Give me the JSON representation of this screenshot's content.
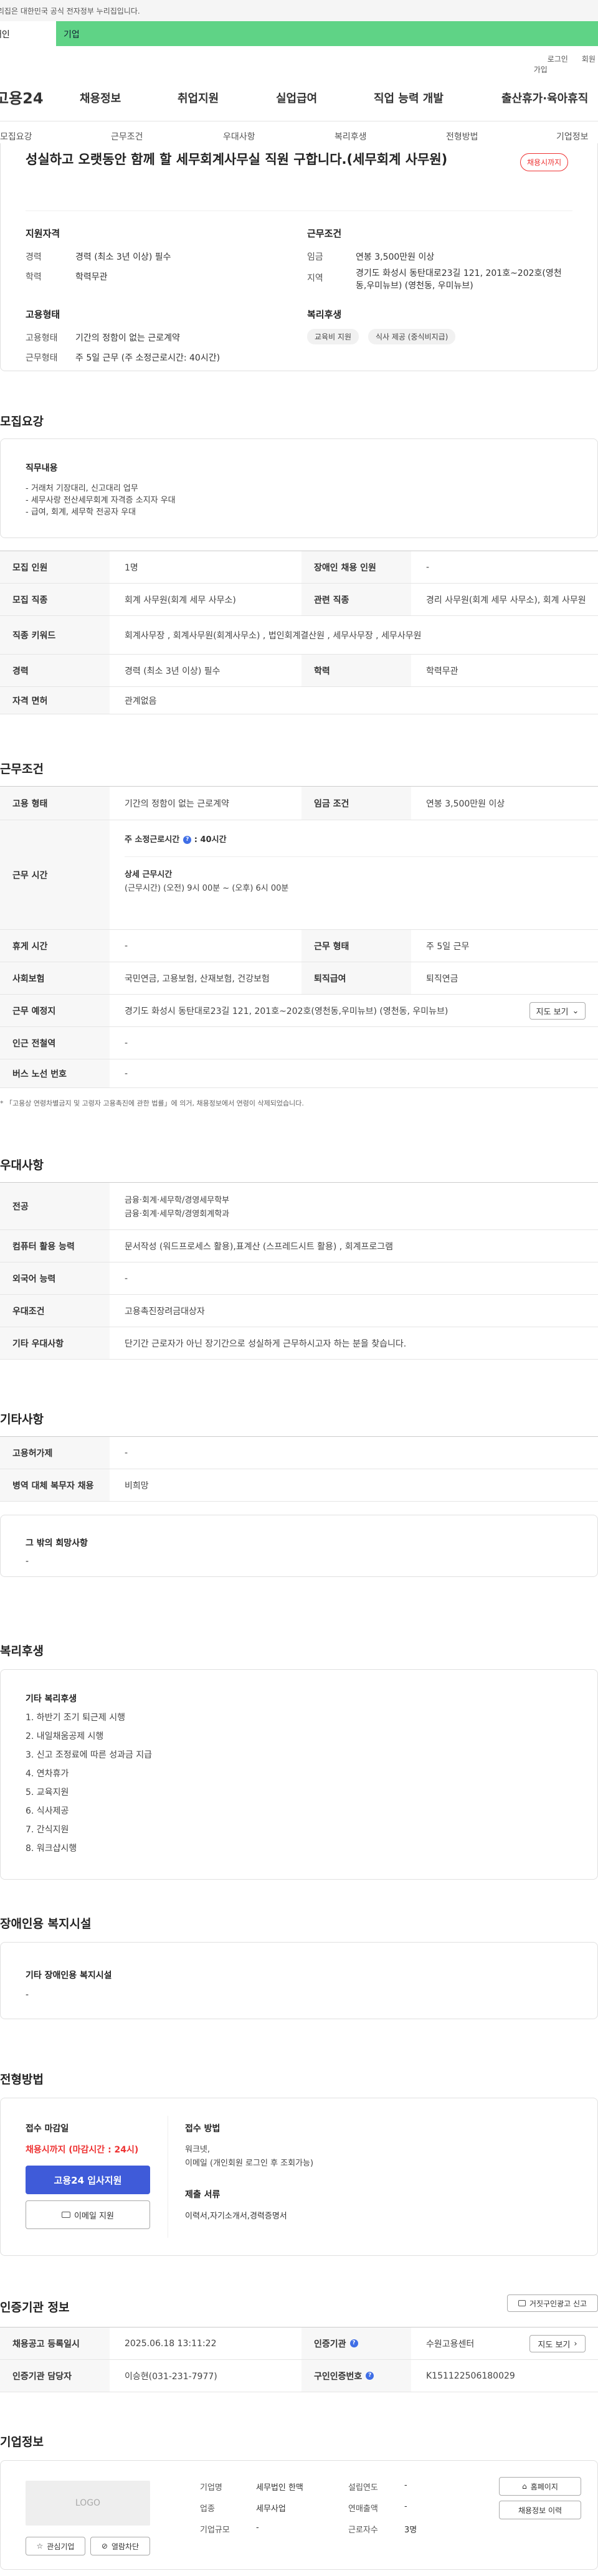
{
  "top": {
    "notice": "이 누리집은 대한민국 공식 전자정부 누리집입니다.",
    "tab_person": "개인",
    "tab_company": "기업",
    "login": "로그인",
    "join": "회원가입"
  },
  "gnb": {
    "logo": "고용24",
    "menu": [
      "채용정보",
      "취업지원",
      "실업급여",
      "직업 능력 개발",
      "출산휴가·육아휴직"
    ]
  },
  "lnb": [
    "모집요강",
    "근무조건",
    "우대사항",
    "복리후생",
    "전형방법",
    "기업정보"
  ],
  "summary": {
    "title": "성실하고 오랫동안 함께 할 세무회계사무실 직원 구합니다.(세무회계 사무원)",
    "status_badge": "채용시까지",
    "qual_head": "지원자격",
    "career_label": "경력",
    "career_value": "경력 (최소 3년 이상) 필수",
    "edu_label": "학력",
    "edu_value": "학력무관",
    "cond_head": "근무조건",
    "pay_label": "임금",
    "pay_value": "연봉 3,500만원 이상",
    "region_label": "지역",
    "region_value_1": "경기도 화성시 동탄대로23길 121, 201호~202호(영천",
    "region_value_2": "동,우미뉴브) (영천동, 우미뉴브)",
    "type_head": "고용형태",
    "emp_label": "고용형태",
    "emp_value": "기간의 정함이 없는 근로계약",
    "work_label": "근무형태",
    "work_value": "주 5일 근무 (주 소정근로시간: 40시간)",
    "welfare_head": "복리후생",
    "welfare_chips": [
      "교육비 지원",
      "식사 제공 (중식비지급)"
    ]
  },
  "recruit": {
    "section_title": "모집요강",
    "duty_head": "직무내용",
    "duty_lines": [
      "- 거래처 기장대리, 신고대리 업무",
      "- 세무사랑 전산세무회계 자격증 소지자 우대",
      "- 급여, 회계, 세무학 전공자 우대"
    ],
    "rows": [
      {
        "th": "모집 인원",
        "td": "1명",
        "th2": "장애인 채용 인원",
        "td2": "-"
      },
      {
        "th": "모집 직종",
        "td": "회계 사무원(회계 세무 사무소)",
        "th2": "관련 직종",
        "td2": "경리 사무원(회계 세무 사무소), 회계 사무원"
      },
      {
        "th": "직종 키워드",
        "td": "회계사무장 , 회계사무원(회계사무소) , 법인회계결산원 , 세무사무장 , 세무사무원"
      },
      {
        "th": "경력",
        "td": "경력 (최소 3년 이상) 필수",
        "th2": "학력",
        "td2": "학력무관"
      },
      {
        "th": "자격 면허",
        "td": "관계없음"
      }
    ]
  },
  "conditions": {
    "section_title": "근무조건",
    "r1": {
      "th": "고용 형태",
      "td": "기간의 정함이 없는 근로계약",
      "th2": "임금 조건",
      "td2": "연봉 3,500만원 이상"
    },
    "r2": {
      "th": "근무 시간",
      "weekly": "주 소정근로시간",
      "weekly_value": "40시간",
      "detail_head": "상세 근무시간",
      "detail_value": "(근무시간) (오전) 9시 00분 ~ (오후) 6시 00분"
    },
    "r3": {
      "th": "휴게 시간",
      "td": "-",
      "th2": "근무 형태",
      "td2": "주 5일 근무"
    },
    "r4": {
      "th": "사회보험",
      "td": "국민연금, 고용보험, 산재보험, 건강보험",
      "th2": "퇴직급여",
      "td2": "퇴직연금"
    },
    "r5": {
      "th": "근무 예정지",
      "td": "경기도 화성시 동탄대로23길 121, 201호~202호(영천동,우미뉴브) (영천동, 우미뉴브)",
      "btn": "지도 보기"
    },
    "r6": {
      "th": "인근 전철역",
      "td": "-"
    },
    "r7": {
      "th": "버스 노선 번호",
      "td": "-"
    },
    "note": "* 「고용상 연령차별금지 및 고령자 고용촉진에 관한 법률」에 의거, 채용정보에서 연령이 삭제되었습니다."
  },
  "prefer": {
    "section_title": "우대사항",
    "rows": [
      {
        "th": "전공",
        "lines": [
          "금융·회계·세무학/경영세무학부",
          "금융·회계·세무학/경영회계학과"
        ]
      },
      {
        "th": "컴퓨터 활용 능력",
        "lines": [
          "문서작성 (워드프로세스 활용),표계산 (스프레드시트 활용) , 회계프로그램"
        ]
      },
      {
        "th": "외국어 능력",
        "lines": [
          "-"
        ]
      },
      {
        "th": "우대조건",
        "lines": [
          "고용촉진장려금대상자"
        ]
      },
      {
        "th": "기타 우대사항",
        "lines": [
          "단기간 근로자가 아닌 장기간으로 성실하게 근무하시고자 하는 분을 찾습니다."
        ]
      }
    ]
  },
  "etc": {
    "section_title": "기타사항",
    "rows": [
      {
        "th": "고용허가제",
        "td": "-"
      },
      {
        "th": "병역 대체 복무자 채용",
        "td": "비희망"
      }
    ],
    "box_head": "그 밖의 희망사항",
    "box_value": "-"
  },
  "welfare": {
    "section_title": "복리후생",
    "box_head": "기타 복리후생",
    "items": [
      "1.  하반기 조기 퇴근제 시행",
      "2.  내일채움공제 시행",
      "3.  신고 조정료에 따른 성과금 지급",
      "4.  연차휴가",
      "5.  교육지원",
      "6.  식사제공",
      "7.  간식지원",
      "8.  워크샵시행"
    ]
  },
  "disabled": {
    "section_title": "장애인용 복지시설",
    "box_head": "기타 장애인용 복지시설",
    "box_value": "-"
  },
  "apply": {
    "section_title": "전형방법",
    "deadline_head": "접수 마감일",
    "deadline_value": "채용시까지 (마감시간 : 24시)",
    "apply_btn": "고용24 입사지원",
    "email_btn": "이메일 지원",
    "method_head": "접수 방법",
    "method_lines": [
      "워크넷,",
      "이메일 (개인회원 로그인 후 조회가능)"
    ],
    "docs_head": "제출 서류",
    "docs_value": "이력서,자기소개서,경력증명서"
  },
  "agency": {
    "section_title": "인증기관 정보",
    "report_btn": "거짓구인광고 신고",
    "r1": {
      "th": "채용공고 등록일시",
      "td": "2025.06.18 13:11:22",
      "th2": "인증기관",
      "td2": "수원고용센터",
      "btn": "지도 보기"
    },
    "r2": {
      "th": "인증기관 담당자",
      "td": "이승현(031-231-7977)",
      "th2": "구인인증번호",
      "td2": "K151122506180029"
    }
  },
  "company": {
    "section_title": "기업정보",
    "logo": "LOGO",
    "fav_btn": "관심기업",
    "block_btn": "열람차단",
    "name_label": "기업명",
    "name_value": "세무법인 한맥",
    "industry_label": "업종",
    "industry_value": "세무사업",
    "size_label": "기업규모",
    "size_value": "-",
    "founded_label": "설립연도",
    "founded_value": "-",
    "sales_label": "연매출액",
    "sales_value": "-",
    "emp_label": "근로자수",
    "emp_value": "3명",
    "home_btn": "홈페이지",
    "history_btn": "채용정보 이력"
  }
}
